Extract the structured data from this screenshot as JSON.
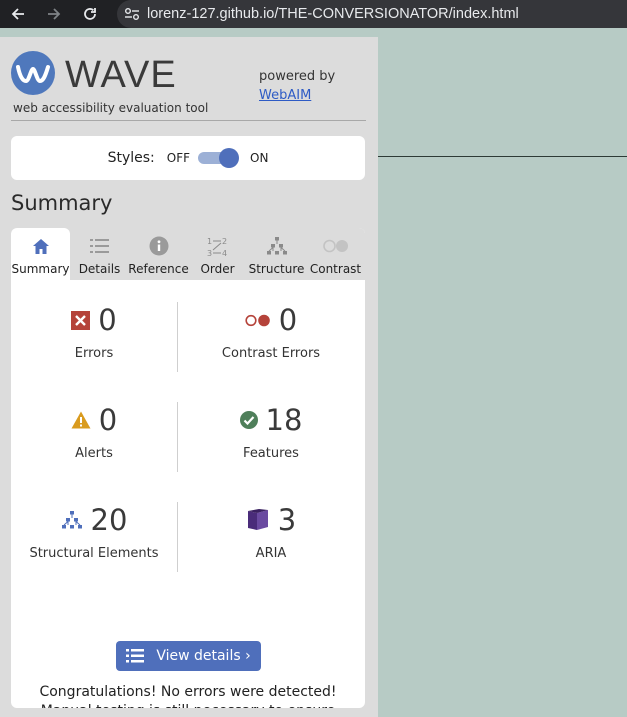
{
  "browser": {
    "url": "lorenz-127.github.io/THE-CONVERSIONATOR/index.html",
    "back_icon": "back-arrow-icon",
    "forward_icon": "forward-arrow-icon",
    "reload_icon": "reload-icon"
  },
  "wave": {
    "logo_text": "WAVE",
    "tagline": "web accessibility evaluation tool",
    "powered_by": "powered by",
    "webaim_link": "WebAIM",
    "styles": {
      "label": "Styles:",
      "off": "OFF",
      "on": "ON",
      "state": "on"
    },
    "heading": "Summary",
    "tabs": [
      {
        "label": "Summary",
        "icon": "home-icon",
        "active": true
      },
      {
        "label": "Details",
        "icon": "list-icon",
        "active": false
      },
      {
        "label": "Reference",
        "icon": "info-icon",
        "active": false
      },
      {
        "label": "Order",
        "icon": "order-icon",
        "active": false
      },
      {
        "label": "Structure",
        "icon": "structure-icon",
        "active": false
      },
      {
        "label": "Contrast",
        "icon": "contrast-icon",
        "active": false
      }
    ],
    "stats": {
      "errors": {
        "value": "0",
        "label": "Errors"
      },
      "contrast_errors": {
        "value": "0",
        "label": "Contrast Errors"
      },
      "alerts": {
        "value": "0",
        "label": "Alerts"
      },
      "features": {
        "value": "18",
        "label": "Features"
      },
      "structural": {
        "value": "20",
        "label": "Structural Elements"
      },
      "aria": {
        "value": "3",
        "label": "ARIA"
      }
    },
    "view_details": "View details ›",
    "congrats": "Congratulations! No errors were detected! Manual testing is still necessary to ensure compliance and optimal accessibility."
  },
  "colors": {
    "accent": "#4f6fbb",
    "error": "#b5433a",
    "alert": "#d99b1e",
    "feature": "#4f7f5a",
    "aria": "#4a2c7a",
    "page_bg": "#b7cbc5"
  }
}
